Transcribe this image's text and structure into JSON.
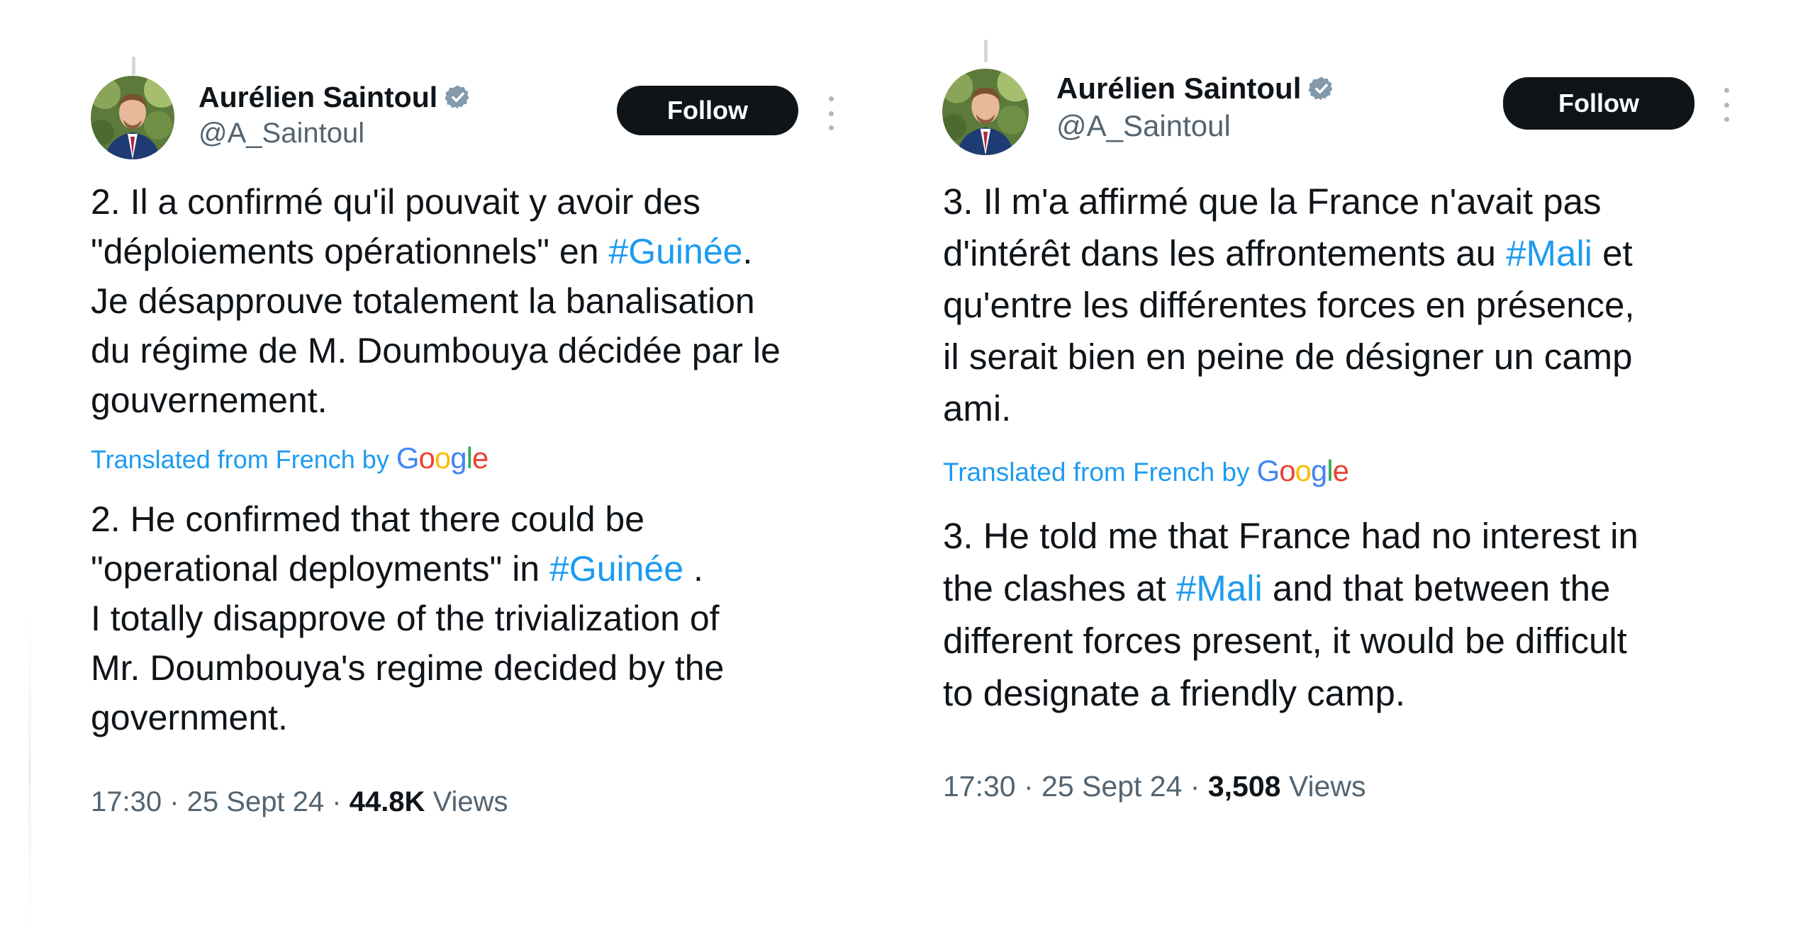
{
  "tweets": [
    {
      "author": {
        "name": "Aurélien Saintoul",
        "handle": "@A_Saintoul",
        "verified": true
      },
      "follow_label": "Follow",
      "original": {
        "l1": "2. Il a confirmé qu'il pouvait y avoir des",
        "l2a": "\"déploiements opérationnels\" en ",
        "l2tag": "#Guinée",
        "l2b": ".",
        "l3": "Je désapprouve totalement la banalisation",
        "l4": "du régime de M. Doumbouya décidée par le",
        "l5": "gouvernement."
      },
      "translated_label": "Translated from French by",
      "translated_brand": "Google",
      "translation": {
        "l1": "2. He confirmed that there could be",
        "l2a": "\"operational deployments\" in ",
        "l2tag": "#Guinée",
        "l2b": " .",
        "l3": "I totally disapprove of the trivialization of",
        "l4": "Mr. Doumbouya's regime decided by the",
        "l5": "government."
      },
      "time": "17:30",
      "date": "25 Sept 24",
      "views_count": "44.8K",
      "views_label": "Views"
    },
    {
      "author": {
        "name": "Aurélien Saintoul",
        "handle": "@A_Saintoul",
        "verified": true
      },
      "follow_label": "Follow",
      "original": {
        "l1": "3. Il m'a affirmé que la France n'avait pas",
        "l2a": "d'intérêt dans les affrontements au ",
        "l2tag": "#Mali",
        "l2b": " et",
        "l3": "qu'entre les différentes forces en présence,",
        "l4": "il serait bien en peine de désigner un camp",
        "l5": "ami."
      },
      "translated_label": "Translated from French by",
      "translated_brand": "Google",
      "translation": {
        "l1": "3. He told me that France had no interest in",
        "l2a": "the clashes at ",
        "l2tag": "#Mali",
        "l2b": " and that between the",
        "l3": "different forces present, it would be difficult",
        "l4": "to designate a friendly camp."
      },
      "time": "17:30",
      "date": "25 Sept 24",
      "views_count": "3,508",
      "views_label": "Views"
    }
  ],
  "colors": {
    "text": "#0f1419",
    "secondary": "#536471",
    "link": "#1d9bf0",
    "follow_bg": "#0f1419"
  }
}
